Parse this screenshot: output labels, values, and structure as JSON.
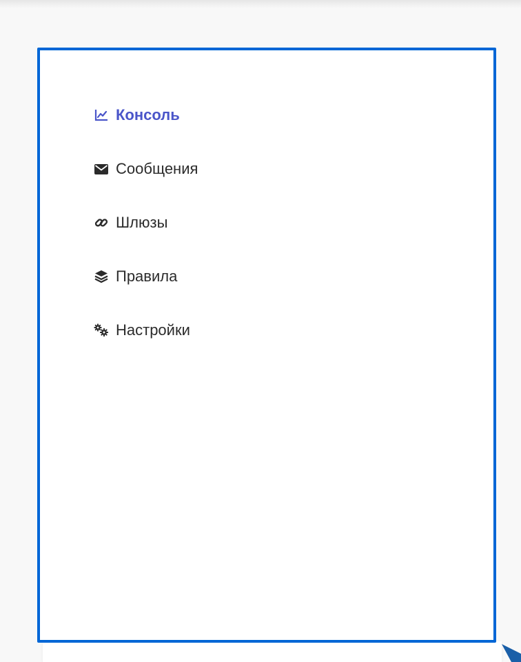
{
  "sidebar": {
    "items": [
      {
        "label": "Консоль",
        "icon": "chart-line-icon",
        "active": true
      },
      {
        "label": "Сообщения",
        "icon": "envelope-icon",
        "active": false
      },
      {
        "label": "Шлюзы",
        "icon": "link-icon",
        "active": false
      },
      {
        "label": "Правила",
        "icon": "layers-icon",
        "active": false
      },
      {
        "label": "Настройки",
        "icon": "cogs-icon",
        "active": false
      }
    ]
  },
  "colors": {
    "accent": "#4a55c9",
    "panel_border": "#0066d6",
    "text": "#2b2b2b",
    "background": "#f8f8f8"
  }
}
